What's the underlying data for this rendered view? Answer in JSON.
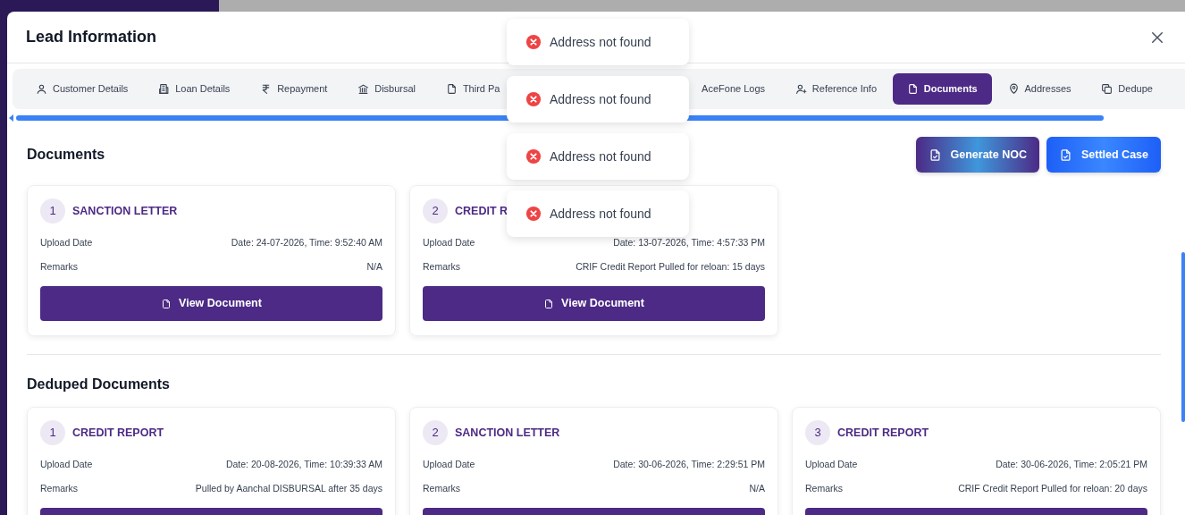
{
  "modal": {
    "title": "Lead Information"
  },
  "tabs": [
    {
      "label": "Customer Details",
      "selected": false
    },
    {
      "label": "Loan Details",
      "selected": false
    },
    {
      "label": "Repayment",
      "selected": false
    },
    {
      "label": "Disbursal",
      "selected": false
    },
    {
      "label": "Third Pa",
      "selected": false
    },
    {
      "label": "AceFone Logs",
      "selected": false
    },
    {
      "label": "Reference Info",
      "selected": false
    },
    {
      "label": "Documents",
      "selected": true
    },
    {
      "label": "Addresses",
      "selected": false
    },
    {
      "label": "Dedupe",
      "selected": false
    }
  ],
  "documents": {
    "heading": "Documents",
    "actions": [
      {
        "label": "Generate NOC",
        "kind": "noc"
      },
      {
        "label": "Settled Case",
        "kind": "settled"
      }
    ],
    "cards": [
      {
        "number": "1",
        "title": "SANCTION LETTER",
        "upload_label": "Upload Date",
        "upload_value": "Date: 24-07-2026, Time: 9:52:40 AM",
        "remarks_label": "Remarks",
        "remarks_value": "N/A",
        "button": "View Document"
      },
      {
        "number": "2",
        "title": "CREDIT R",
        "upload_label": "Upload Date",
        "upload_value": "Date: 13-07-2026, Time: 4:57:33 PM",
        "remarks_label": "Remarks",
        "remarks_value": "CRIF Credit Report Pulled for reloan: 15 days",
        "button": "View Document"
      }
    ]
  },
  "deduped": {
    "heading": "Deduped Documents",
    "cards": [
      {
        "number": "1",
        "title": "CREDIT REPORT",
        "upload_label": "Upload Date",
        "upload_value": "Date: 20-08-2026, Time: 10:39:33 AM",
        "remarks_label": "Remarks",
        "remarks_value": "Pulled by Aanchal DISBURSAL after 35 days"
      },
      {
        "number": "2",
        "title": "SANCTION LETTER",
        "upload_label": "Upload Date",
        "upload_value": "Date: 30-06-2026, Time: 2:29:51 PM",
        "remarks_label": "Remarks",
        "remarks_value": "N/A"
      },
      {
        "number": "3",
        "title": "CREDIT REPORT",
        "upload_label": "Upload Date",
        "upload_value": "Date: 30-06-2026, Time: 2:05:21 PM",
        "remarks_label": "Remarks",
        "remarks_value": "CRIF Credit Report Pulled for reloan: 20 days"
      }
    ]
  },
  "toasts": [
    {
      "message": "Address not found"
    },
    {
      "message": "Address not found"
    },
    {
      "message": "Address not found"
    },
    {
      "message": "Address not found"
    }
  ]
}
